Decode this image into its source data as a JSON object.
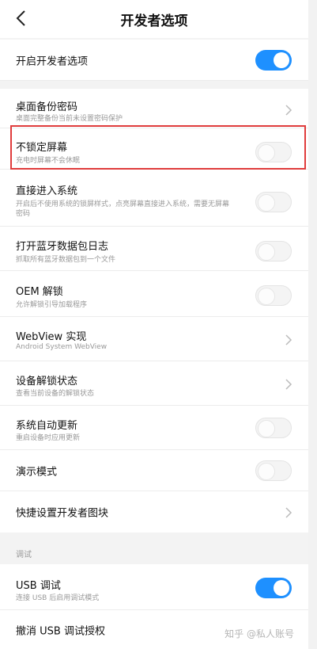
{
  "header": {
    "title": "开发者选项"
  },
  "rows": {
    "enable_dev": {
      "label": "开启开发者选项",
      "state": "on"
    },
    "backup_pw": {
      "label": "桌面备份密码",
      "sub": "桌面完整备份当前未设置密码保护"
    },
    "stay_awake": {
      "label": "不锁定屏幕",
      "sub": "充电时屏幕不会休眠",
      "state": "off"
    },
    "direct_boot": {
      "label": "直接进入系统",
      "sub": "开启后不使用系统的锁屏样式，点亮屏幕直接进入系统，需要无屏幕",
      "sub2": "密码",
      "state": "off"
    },
    "bt_log": {
      "label": "打开蓝牙数据包日志",
      "sub": "抓取所有蓝牙数据包到一个文件",
      "state": "off"
    },
    "oem_unlock": {
      "label": "OEM 解锁",
      "sub": "允许解锁引导加载程序",
      "state": "off"
    },
    "webview": {
      "label": "WebView 实现",
      "sub": "Android System WebView"
    },
    "unlock_status": {
      "label": "设备解锁状态",
      "sub": "查看当前设备的解锁状态"
    },
    "auto_update": {
      "label": "系统自动更新",
      "sub": "重启设备时应用更新",
      "state": "off"
    },
    "demo_mode": {
      "label": "演示模式",
      "state": "off"
    },
    "quick_tiles": {
      "label": "快捷设置开发者图块"
    }
  },
  "debug_section": {
    "title": "调试",
    "usb_debug": {
      "label": "USB 调试",
      "sub": "连接 USB 后启用调试模式",
      "state": "on"
    },
    "revoke_usb": {
      "label": "撤消 USB 调试授权"
    }
  },
  "watermark": "知乎 @私人账号",
  "colors": {
    "toggle_on": "#1e90ff",
    "highlight": "#e03c3c"
  }
}
